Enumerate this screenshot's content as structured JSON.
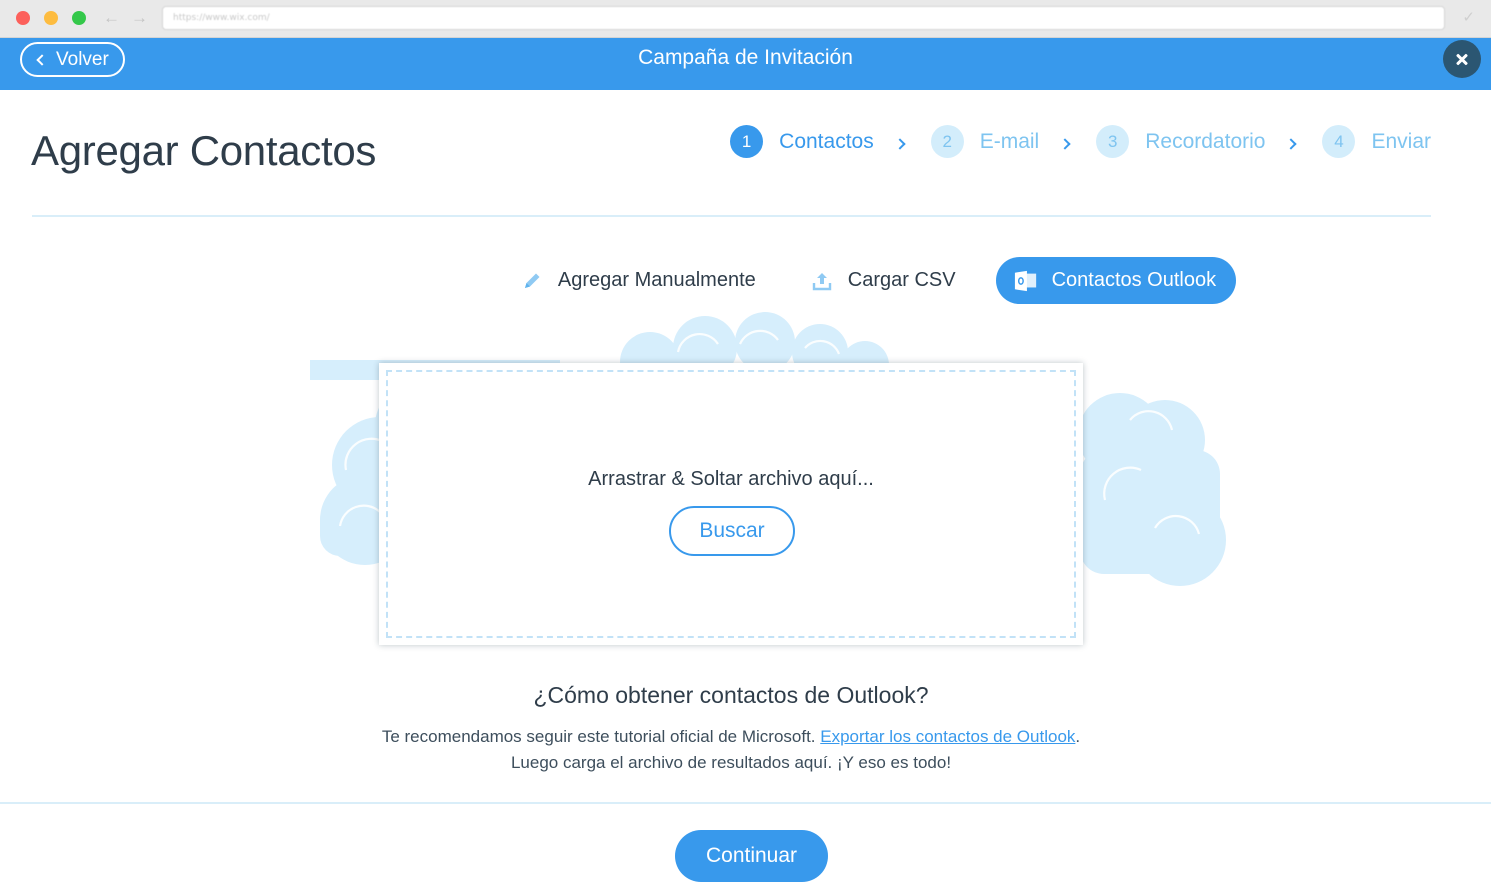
{
  "browser": {
    "url": "https://www.wix.com/",
    "icons": {
      "back": "arrow-left-icon",
      "forward": "arrow-right-icon",
      "tool": "wrench-icon"
    }
  },
  "header": {
    "back_label": "Volver",
    "title": "Campaña de Invitación",
    "close_icon": "close-icon",
    "color": "#3899ec"
  },
  "page": {
    "title": "Agregar Contactos"
  },
  "stepper": {
    "steps": [
      {
        "num": "1",
        "label": "Contactos",
        "active": true
      },
      {
        "num": "2",
        "label": "E-mail",
        "active": false
      },
      {
        "num": "3",
        "label": "Recordatorio",
        "active": false
      },
      {
        "num": "4",
        "label": "Enviar",
        "active": false
      }
    ]
  },
  "tabs": [
    {
      "label": "Agregar Manualmente",
      "icon": "pencil-icon",
      "active": false
    },
    {
      "label": "Cargar CSV",
      "icon": "upload-icon",
      "active": false
    },
    {
      "label": "Contactos Outlook",
      "icon": "outlook-icon",
      "active": true
    }
  ],
  "dropzone": {
    "text": "Arrastrar & Soltar archivo aquí...",
    "browse_label": "Buscar"
  },
  "help": {
    "title": "¿Cómo obtener contactos de Outlook?",
    "text_before": "Te recomendamos seguir este tutorial oficial de Microsoft. ",
    "link_label": "Exportar los contactos de Outlook",
    "text_after": ". Luego carga el archivo de resultados aquí. ¡Y eso es todo!"
  },
  "footer": {
    "continue_label": "Continuar"
  }
}
